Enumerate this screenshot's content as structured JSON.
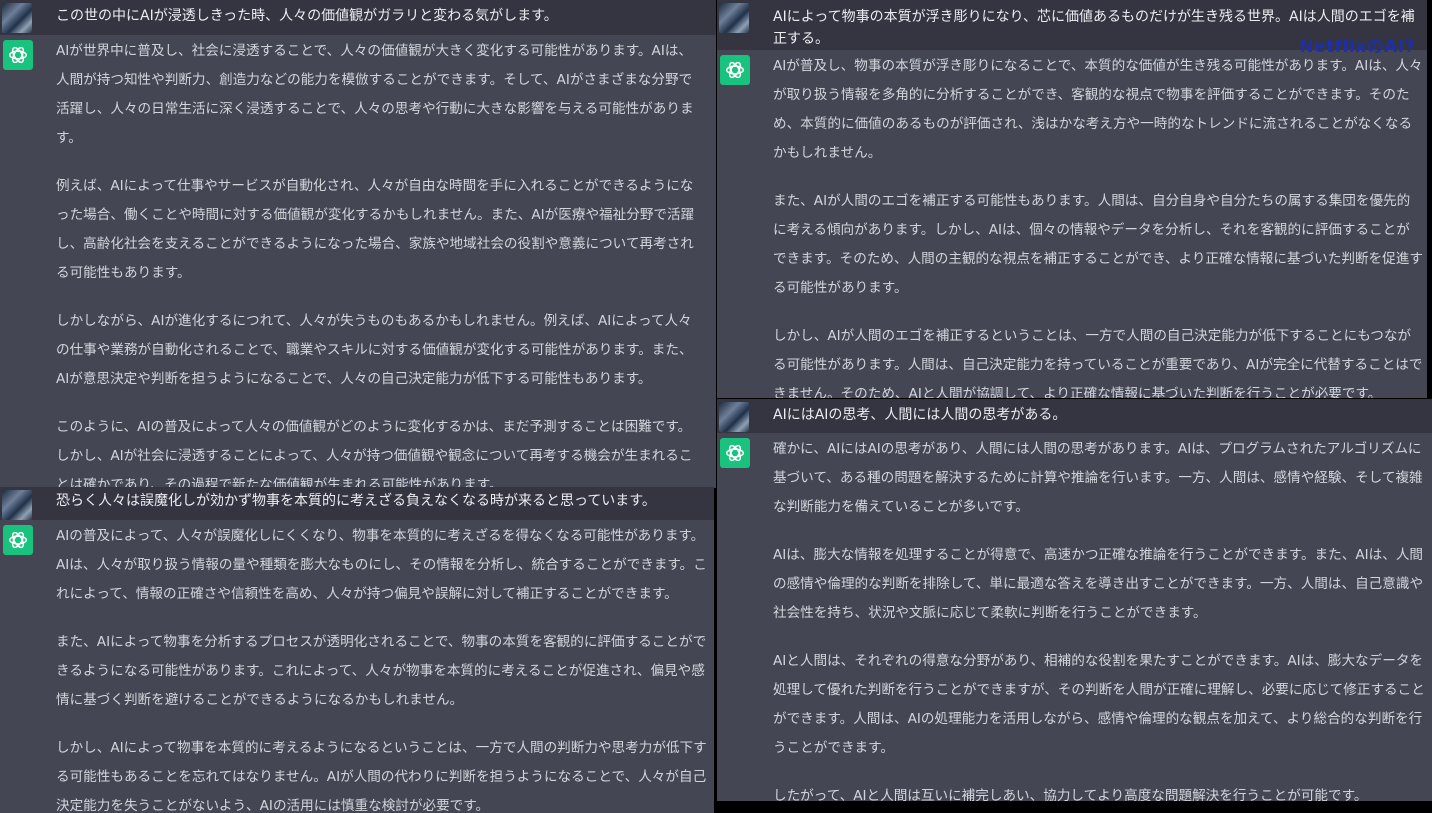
{
  "panels": [
    {
      "user": "この世の中にAIが浸透しきった時、人々の価値観がガラリと変わる気がします。",
      "paragraphs": [
        "AIが世界中に普及し、社会に浸透することで、人々の価値観が大きく変化する可能性があります。AIは、人間が持つ知性や判断力、創造力などの能力を模倣することができます。そして、AIがさまざまな分野で活躍し、人々の日常生活に深く浸透することで、人々の思考や行動に大きな影響を与える可能性があります。",
        "例えば、AIによって仕事やサービスが自動化され、人々が自由な時間を手に入れることができるようになった場合、働くことや時間に対する価値観が変化するかもしれません。また、AIが医療や福祉分野で活躍し、高齢化社会を支えることができるようになった場合、家族や地域社会の役割や意義について再考される可能性もあります。",
        "しかしながら、AIが進化するにつれて、人々が失うものもあるかもしれません。例えば、AIによって人々の仕事や業務が自動化されることで、職業やスキルに対する価値観が変化する可能性があります。また、AIが意思決定や判断を担うようになることで、人々の自己決定能力が低下する可能性もあります。",
        "このように、AIの普及によって人々の価値観がどのように変化するかは、まだ予測することは困難です。しかし、AIが社会に浸透することによって、人々が持つ価値観や観念について再考する機会が生まれることは確かであり、その過程で新たな価値観が生まれる可能性があります。"
      ]
    },
    {
      "user": "AIによって物事の本質が浮き彫りになり、芯に価値あるものだけが生き残る世界。AIは人間のエゴを補正する。",
      "paragraphs": [
        "AIが普及し、物事の本質が浮き彫りになることで、本質的な価値が生き残る可能性があります。AIは、人々が取り扱う情報を多角的に分析することができ、客観的な視点で物事を評価することができます。そのため、本質的に価値のあるものが評価され、浅はかな考え方や一時的なトレンドに流されることがなくなるかもしれません。",
        "また、AIが人間のエゴを補正する可能性もあります。人間は、自分自身や自分たちの属する集団を優先的に考える傾向があります。しかし、AIは、個々の情報やデータを分析し、それを客観的に評価することができます。そのため、人間の主観的な視点を補正することができ、より正確な情報に基づいた判断を促進する可能性があります。",
        "しかし、AIが人間のエゴを補正するということは、一方で人間の自己決定能力が低下することにもつながる可能性があります。人間は、自己決定能力を持っていることが重要であり、AIが完全に代替することはできません。そのため、AIと人間が協調して、より正確な情報に基づいた判断を行うことが必要です。"
      ],
      "watermark": "NetflixのAI?"
    },
    {
      "user": "恐らく人々は誤魔化しが効かず物事を本質的に考えざる負えなくなる時が来ると思っています。",
      "paragraphs": [
        "AIの普及によって、人々が誤魔化しにくくなり、物事を本質的に考えざるを得なくなる可能性があります。AIは、人々が取り扱う情報の量や種類を膨大なものにし、その情報を分析し、統合することができます。これによって、情報の正確さや信頼性を高め、人々が持つ偏見や誤解に対して補正することができます。",
        "また、AIによって物事を分析するプロセスが透明化されることで、物事の本質を客観的に評価することができるようになる可能性があります。これによって、人々が物事を本質的に考えることが促進され、偏見や感情に基づく判断を避けることができるようになるかもしれません。",
        "しかし、AIによって物事を本質的に考えるようになるということは、一方で人間の判断力や思考力が低下する可能性もあることを忘れてはなりません。AIが人間の代わりに判断を担うようになることで、人々が自己決定能力を失うことがないよう、AIの活用には慎重な検討が必要です。"
      ]
    },
    {
      "user": "AIにはAIの思考、人間には人間の思考がある。",
      "paragraphs": [
        "確かに、AIにはAIの思考があり、人間には人間の思考があります。AIは、プログラムされたアルゴリズムに基づいて、ある種の問題を解決するために計算や推論を行います。一方、人間は、感情や経験、そして複雑な判断能力を備えていることが多いです。",
        "AIは、膨大な情報を処理することが得意で、高速かつ正確な推論を行うことができます。また、AIは、人間の感情や倫理的な判断を排除して、単に最適な答えを導き出すことができます。一方、人間は、自己意識や社会性を持ち、状況や文脈に応じて柔軟に判断を行うことができます。",
        "AIと人間は、それぞれの得意な分野があり、相補的な役割を果たすことができます。AIは、膨大なデータを処理して優れた判断を行うことができますが、その判断を人間が正確に理解し、必要に応じて修正することができます。人間は、AIの処理能力を活用しながら、感情や倫理的な観点を加えて、より総合的な判断を行うことができます。",
        "したがって、AIと人間は互いに補完しあい、協力してより高度な問題解決を行うことが可能です。"
      ]
    }
  ]
}
